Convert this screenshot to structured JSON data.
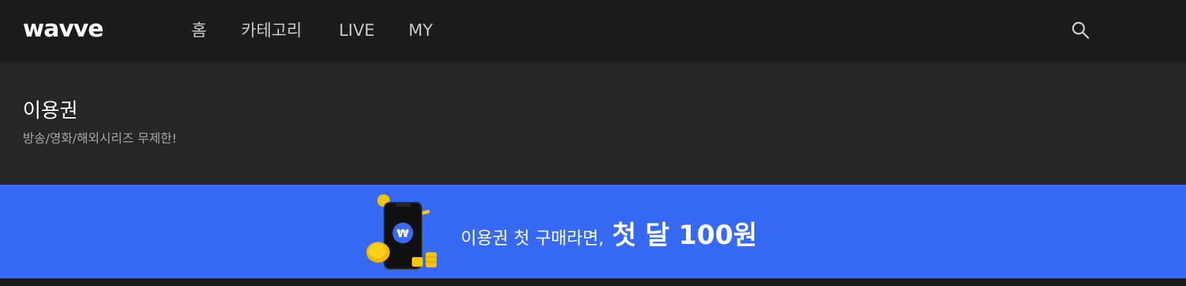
{
  "header": {
    "logo": "wavve",
    "nav": [
      {
        "label": "홈"
      },
      {
        "label": "카테고리"
      },
      {
        "label": "LIVE"
      },
      {
        "label": "MY"
      }
    ],
    "search_icon": "search-icon"
  },
  "title_area": {
    "title": "이용권",
    "subtitle": "방송/영화/해외시리즈 무제한!"
  },
  "banner": {
    "text_normal": "이용권 첫 구매라면,",
    "text_strong": "첫 달 100원",
    "illustration": "phone-coin-icon",
    "coin_symbol": "₩",
    "colors": {
      "background": "#376af4",
      "coin": "#f7c500"
    }
  },
  "colors": {
    "header_bg": "#1c1c1c",
    "title_area_bg": "#262626",
    "nav_text": "#c9c9c9"
  }
}
